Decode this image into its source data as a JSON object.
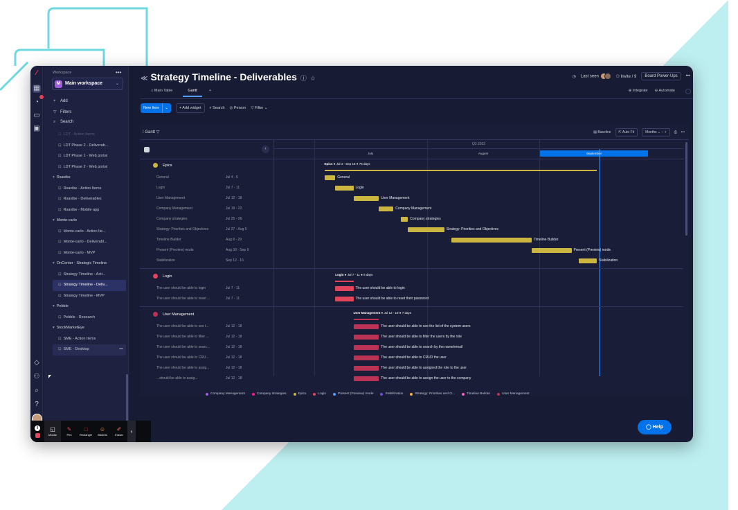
{
  "workspace": {
    "label": "Workspace",
    "more": "•••",
    "badge": "M",
    "name": "Main workspace",
    "actions": [
      {
        "icon": "+",
        "label": "Add"
      },
      {
        "icon": "▽",
        "label": "Filters"
      },
      {
        "icon": "⌕",
        "label": "Search"
      }
    ],
    "tree": [
      {
        "type": "board",
        "label": "LDT - Action Items",
        "faded": true
      },
      {
        "type": "board",
        "label": "LDT Phase 2 - Deliverab..."
      },
      {
        "type": "board",
        "label": "LDT Phase 1 - Web portal"
      },
      {
        "type": "board",
        "label": "LDT Phase 2 - Web portal"
      },
      {
        "type": "folder",
        "label": "Rsavibe"
      },
      {
        "type": "board",
        "label": "Rsavibe - Action Items"
      },
      {
        "type": "board",
        "label": "Rsavibe - Deliverables"
      },
      {
        "type": "board",
        "label": "Rsavibe - Mobile app"
      },
      {
        "type": "folder",
        "label": "Monte-carlo"
      },
      {
        "type": "board",
        "label": "Monte-carlo - Action Ite..."
      },
      {
        "type": "board",
        "label": "Monte-carlo - Deliverabl..."
      },
      {
        "type": "board",
        "label": "Monte-carlo - MVP"
      },
      {
        "type": "folder",
        "label": "OnCenter - Strategic Timeline"
      },
      {
        "type": "board",
        "label": "Strategy Timeline - Acti..."
      },
      {
        "type": "board",
        "label": "Strategy Timeline - Deliv...",
        "selected": true
      },
      {
        "type": "board",
        "label": "Strategy Timeline - MVP"
      },
      {
        "type": "folder",
        "label": "Pebble"
      },
      {
        "type": "board",
        "label": "Pebble - Research"
      },
      {
        "type": "folder",
        "label": "StockMarketEye"
      },
      {
        "type": "board",
        "label": "SME - Action Items"
      },
      {
        "type": "board",
        "label": "SME - Desktop",
        "hover": true,
        "dots": "•••"
      }
    ]
  },
  "recorder": {
    "tools": [
      "Mouse",
      "Pen",
      "Rectangle",
      "Stickers",
      "Eraser"
    ]
  },
  "board": {
    "title": "Strategy Timeline - Deliverables",
    "last_seen": "Last seen",
    "invite": "Invite / 9",
    "power_ups": "Board Power-Ups",
    "more": "•••",
    "tabs": [
      "Main Table",
      "Gantt"
    ],
    "tab_add": "+",
    "integrate": "Integrate",
    "automate": "Automate",
    "new_item": "New Item",
    "add_widget": "Add widget",
    "search": "Search",
    "person": "Person",
    "filter": "Filter"
  },
  "gantt": {
    "title": "Gantt",
    "baseline": "Baseline",
    "auto_fit": "Auto Fit",
    "scale": "Months",
    "quarter": "Q3 2022",
    "months": [
      "July",
      "August",
      "September"
    ],
    "groups": [
      {
        "name": "Epics",
        "color": "#cab641",
        "summary": {
          "name": "Epics",
          "range": "Jul 4 - Sep 16",
          "days": "75 days"
        },
        "items": [
          {
            "name": "General",
            "date": "Jul 4 - 6",
            "start": 4,
            "end": 6
          },
          {
            "name": "Login",
            "date": "Jul 7 - 11",
            "start": 7,
            "end": 11
          },
          {
            "name": "User Management",
            "date": "Jul 12 - 18",
            "start": 12,
            "end": 18
          },
          {
            "name": "Company Management",
            "date": "Jul 19 - 22",
            "start": 19,
            "end": 22
          },
          {
            "name": "Company strategies",
            "date": "Jul 25 - 26",
            "start": 25,
            "end": 26
          },
          {
            "name": "Strategy: Priorities and Objectives",
            "date": "Jul 27 - Aug 5",
            "start": 27,
            "end": 36
          },
          {
            "name": "Timeline Builder",
            "date": "Aug 8 - 29",
            "start": 39,
            "end": 60
          },
          {
            "name": "Present (Preview) mode",
            "date": "Aug 30 - Sep 9",
            "start": 61,
            "end": 71
          },
          {
            "name": "Stabilization",
            "date": "Sep 12 - 16",
            "start": 74,
            "end": 78
          }
        ]
      },
      {
        "name": "Login",
        "color": "#e2445c",
        "summary": {
          "name": "Login",
          "range": "Jul 7 - 11",
          "days": "5 days"
        },
        "items": [
          {
            "name": "The user should be able to login",
            "date": "Jul 7 - 11",
            "start": 7,
            "end": 11,
            "label": "The user should be able to login"
          },
          {
            "name": "The user should be able to reset ...",
            "date": "Jul 7 - 11",
            "start": 7,
            "end": 11,
            "label": "The user should be able to reset their password"
          }
        ]
      },
      {
        "name": "User Management",
        "color": "#bb3354",
        "summary": {
          "name": "User Management",
          "range": "Jul 12 - 18",
          "days": "7 days"
        },
        "items": [
          {
            "name": "The user should be able to see t...",
            "date": "Jul 12 - 18",
            "start": 12,
            "end": 18,
            "label": "The user should be able to see the list of the system users"
          },
          {
            "name": "The user should be able to filter ...",
            "date": "Jul 12 - 18",
            "start": 12,
            "end": 18,
            "label": "The user should be able to filter the users by the role"
          },
          {
            "name": "The user should be able to searc...",
            "date": "Jul 12 - 18",
            "start": 12,
            "end": 18,
            "label": "The user should be able to search by the name/email"
          },
          {
            "name": "The user should be able to CRU...",
            "date": "Jul 12 - 18",
            "start": 12,
            "end": 18,
            "label": "The user should be able to CRUD the user"
          },
          {
            "name": "The user should be able to assig...",
            "date": "Jul 12 - 18",
            "start": 12,
            "end": 18,
            "label": "The user should be able to assigned the role to the user"
          },
          {
            "name": "...should be able to assig...",
            "date": "Jul 12 - 18",
            "start": 12,
            "end": 18,
            "label": "The user should be able to assign the user to the company"
          }
        ]
      }
    ],
    "legend": [
      {
        "name": "Company Management",
        "color": "#a25ddc"
      },
      {
        "name": "Company strategies",
        "color": "#ff158a"
      },
      {
        "name": "Epics",
        "color": "#cab641"
      },
      {
        "name": "Login",
        "color": "#e2445c"
      },
      {
        "name": "Present (Preview) mode",
        "color": "#579bfc"
      },
      {
        "name": "Stabilization",
        "color": "#784bd1"
      },
      {
        "name": "Strategy: Priorities and O...",
        "color": "#fdab3d"
      },
      {
        "name": "Timeline Builder",
        "color": "#ff5ac4"
      },
      {
        "name": "User Management",
        "color": "#bb3354"
      }
    ]
  },
  "help": "Help"
}
